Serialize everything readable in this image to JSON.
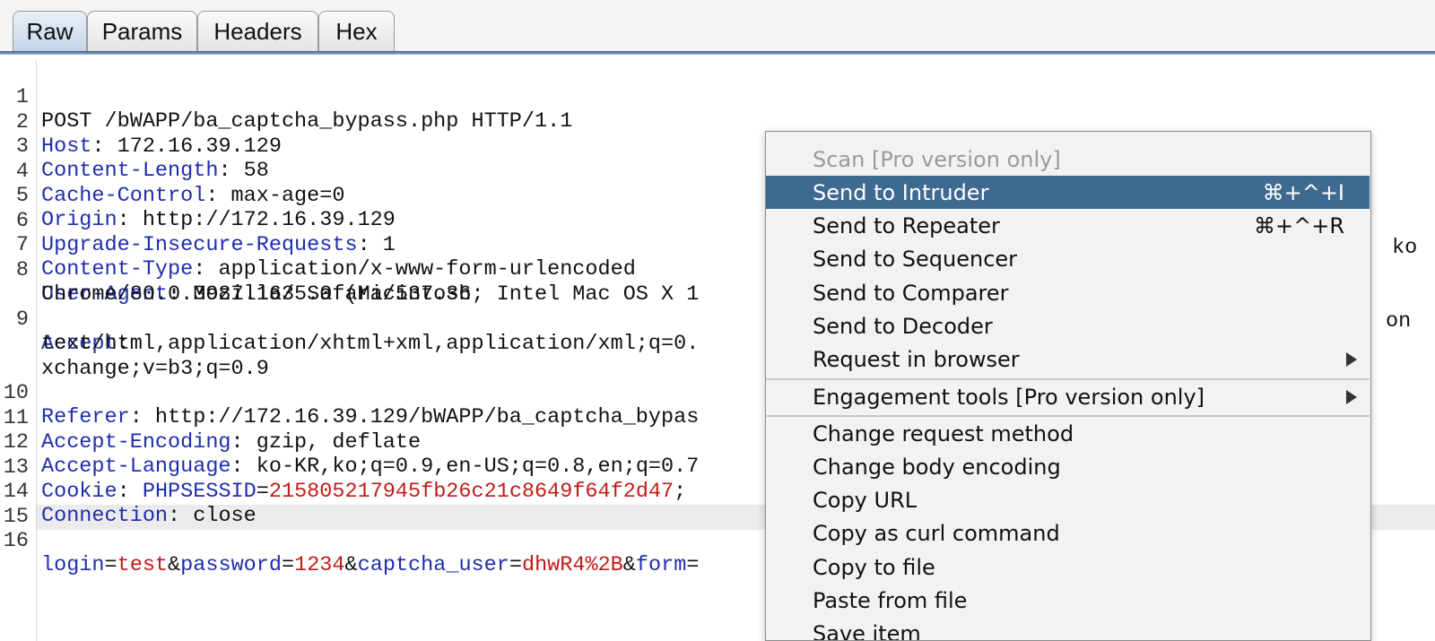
{
  "tabs": [
    {
      "label": "Raw",
      "active": true
    },
    {
      "label": "Params",
      "active": false
    },
    {
      "label": "Headers",
      "active": false
    },
    {
      "label": "Hex",
      "active": false
    }
  ],
  "request": {
    "line1": {
      "num": "1",
      "text": "POST /bWAPP/ba_captcha_bypass.php HTTP/1.1"
    },
    "line2": {
      "num": "2",
      "key": "Host",
      "value": ": 172.16.39.129"
    },
    "line3": {
      "num": "3",
      "key": "Content-Length",
      "value": ": 58"
    },
    "line4": {
      "num": "4",
      "key": "Cache-Control",
      "value": ": max-age=0"
    },
    "line5": {
      "num": "5",
      "key": "Origin",
      "value": ": http://172.16.39.129"
    },
    "line6": {
      "num": "6",
      "key": "Upgrade-Insecure-Requests",
      "value": ": 1"
    },
    "line7": {
      "num": "7",
      "key": "Content-Type",
      "value": ": application/x-www-form-urlencoded"
    },
    "line8": {
      "num": "8",
      "key": "User-Agent",
      "value": ": Mozilla/5.0 (Macintosh; Intel Mac OS X 1",
      "cont": "Chrome/80.0.3987.163 Safari/537.36",
      "cut": "ko"
    },
    "line9": {
      "num": "9",
      "key": "Accept",
      "value": ":",
      "cont1": "text/html,application/xhtml+xml,application/xml;q=0.",
      "cont2": "xchange;v=b3;q=0.9",
      "cut": "on"
    },
    "line10": {
      "num": "10",
      "key": "Referer",
      "value": ": http://172.16.39.129/bWAPP/ba_captcha_bypas"
    },
    "line11": {
      "num": "11",
      "key": "Accept-Encoding",
      "value": ": gzip, deflate"
    },
    "line12": {
      "num": "12",
      "key": "Accept-Language",
      "value": ": ko-KR,ko;q=0.9,en-US;q=0.8,en;q=0.7"
    },
    "line13": {
      "num": "13",
      "key": "Cookie",
      "colon": ": ",
      "pkey": "PHPSESSID",
      "eq": "=",
      "pval": "215805217945fb26c21c8649f64f2d47",
      "tail": ";"
    },
    "line14": {
      "num": "14",
      "key": "Connection",
      "value": ": close"
    },
    "line15": {
      "num": "15"
    },
    "line16": {
      "num": "16",
      "p1k": "login",
      "p1v": "test",
      "p2k": "password",
      "p2v": "1234",
      "p3k": "captcha_user",
      "p3v": "dhwR4%2B",
      "p4k": "form",
      "eq": "=",
      "amp": "&"
    }
  },
  "menu": {
    "scan": "Scan [Pro version only]",
    "intruder": {
      "label": "Send to Intruder",
      "shortcut": "⌘+^+I"
    },
    "repeater": {
      "label": "Send to Repeater",
      "shortcut": "⌘+^+R"
    },
    "sequencer": "Send to Sequencer",
    "comparer": "Send to Comparer",
    "decoder": "Send to Decoder",
    "browser": "Request in browser",
    "engagement": "Engagement tools [Pro version only]",
    "change_method": "Change request method",
    "change_encoding": "Change body encoding",
    "copy_url": "Copy URL",
    "copy_curl": "Copy as curl command",
    "copy_file": "Copy to file",
    "paste_file": "Paste from file",
    "save_item": "Save item"
  },
  "colors": {
    "header_key": "#1f2dab",
    "param_value": "#c11b17",
    "menu_selected": "#3e6a92",
    "tab_rule": "#6f8eb0"
  }
}
